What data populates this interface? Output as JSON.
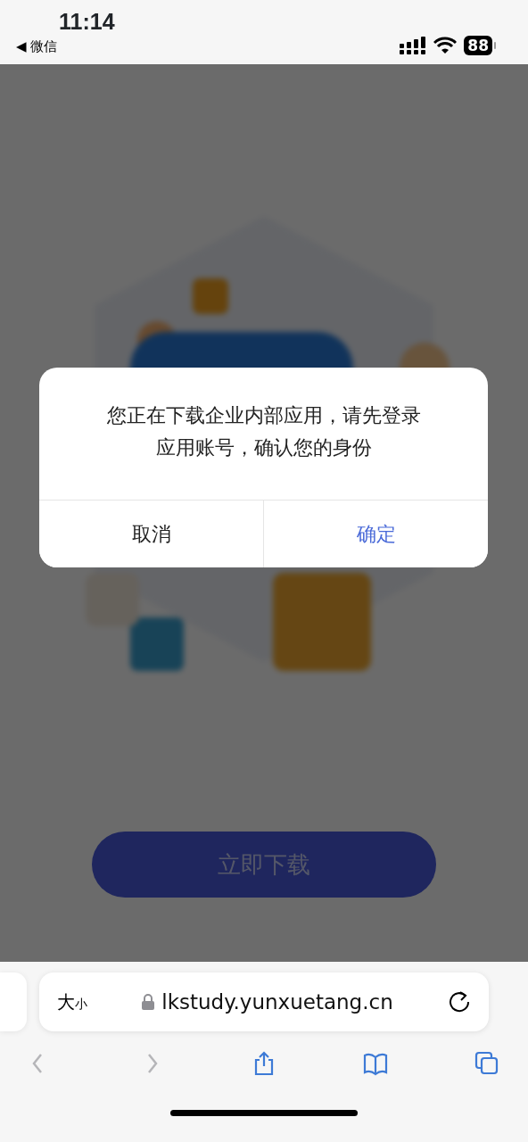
{
  "status_bar": {
    "time": "11:14",
    "back_label": "◀ 微信",
    "battery": "88"
  },
  "page": {
    "download_button": "立即下载"
  },
  "dialog": {
    "message": "您正在下载企业内部应用，请先登录应用账号，确认您的身份",
    "buttons": [
      {
        "label": "取消",
        "kind": "cancel"
      },
      {
        "label": "确定",
        "kind": "confirm"
      }
    ]
  },
  "browser": {
    "text_size": {
      "large": "大",
      "small": "小"
    },
    "url": "lkstudy.yunxuetang.cn",
    "secure": true,
    "toolbar": [
      {
        "kind": "back",
        "disabled": true
      },
      {
        "kind": "forward",
        "disabled": true
      },
      {
        "kind": "share",
        "disabled": false
      },
      {
        "kind": "bookmarks",
        "disabled": false
      },
      {
        "kind": "tabs",
        "disabled": false
      }
    ]
  }
}
